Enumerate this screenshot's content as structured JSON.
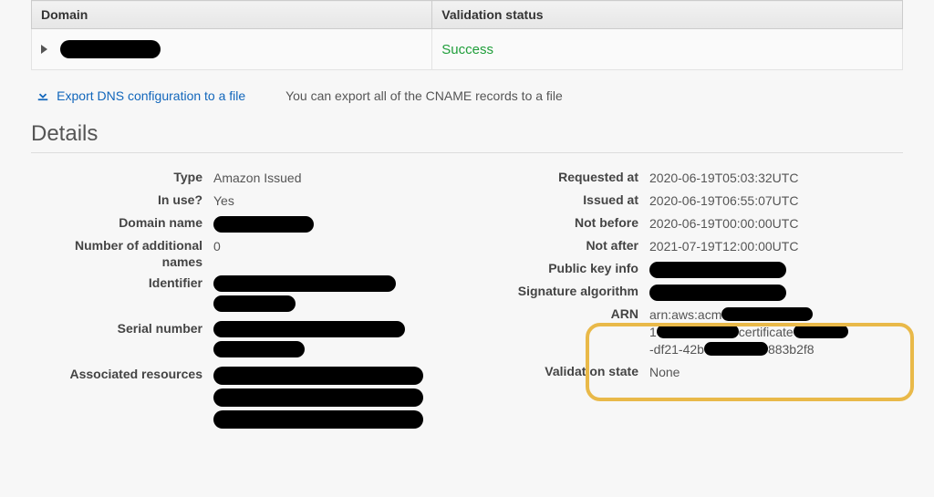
{
  "validation": {
    "headers": {
      "domain": "Domain",
      "status": "Validation status"
    },
    "row": {
      "domain_redacted": true,
      "status_text": "Success"
    }
  },
  "export": {
    "link_text": "Export DNS configuration to a file",
    "note": "You can export all of the CNAME records to a file"
  },
  "details_header": "Details",
  "left": {
    "type_label": "Type",
    "type_value": "Amazon Issued",
    "inuse_label": "In use?",
    "inuse_value": "Yes",
    "domain_label": "Domain name",
    "addnames_label": "Number of additional names",
    "addnames_value": "0",
    "identifier_label": "Identifier",
    "serial_label": "Serial number",
    "assoc_label": "Associated resources"
  },
  "right": {
    "requested_label": "Requested at",
    "requested_value": "2020-06-19T05:03:32UTC",
    "issued_label": "Issued at",
    "issued_value": "2020-06-19T06:55:07UTC",
    "notbefore_label": "Not before",
    "notbefore_value": "2020-06-19T00:00:00UTC",
    "notafter_label": "Not after",
    "notafter_value": "2021-07-19T12:00:00UTC",
    "pubkey_label": "Public key info",
    "sigalg_label": "Signature algorithm",
    "arn_label": "ARN",
    "arn_parts": {
      "prefix": "arn:aws:acm",
      "line2a": "1",
      "line2b": "certificate",
      "line3a": "-df21-42b",
      "line3b": "883b2f8"
    },
    "valstate_label": "Validation state",
    "valstate_value": "None"
  }
}
